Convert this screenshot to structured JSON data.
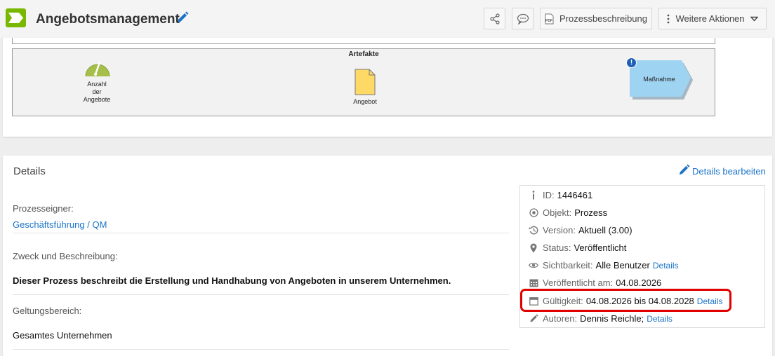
{
  "header": {
    "title": "Angebotsmanagement",
    "process_description_label": "Prozessbeschreibung",
    "more_actions_label": "Weitere Aktionen",
    "pdf_badge": "PDF"
  },
  "diagram": {
    "artefacts_title": "Artefakte",
    "gauge_label": "Anzahl\nder\nAngebote",
    "document_label": "Angebot",
    "measure_label": "Maßnahme",
    "info_badge": "!"
  },
  "details": {
    "title": "Details",
    "edit_label": "Details bearbeiten",
    "owner_label": "Prozesseigner:",
    "owner_value": "Geschäftsführung / QM",
    "purpose_label": "Zweck und Beschreibung:",
    "purpose_value": "Dieser Prozess beschreibt die Erstellung und Handhabung von Angeboten in unserem Unternehmen.",
    "scope_label": "Geltungsbereich:",
    "scope_value": "Gesamtes Unternehmen"
  },
  "meta": {
    "id_key": "ID:",
    "id_val": "1446461",
    "object_key": "Objekt:",
    "object_val": "Prozess",
    "version_key": "Version:",
    "version_val": "Aktuell (3.00)",
    "status_key": "Status:",
    "status_val": "Veröffentlicht",
    "visibility_key": "Sichtbarkeit:",
    "visibility_val": "Alle Benutzer",
    "visibility_link": "Details",
    "published_key": "Veröffentlicht am:",
    "published_val": "04.08.2026",
    "validity_key": "Gültigkeit:",
    "validity_val": "04.08.2026 bis 04.08.2028",
    "validity_link": "Details",
    "authors_key": "Autoren:",
    "authors_val": "Dennis Reichle;",
    "authors_link": "Details"
  },
  "colors": {
    "brand_green": "#7ab800",
    "link_blue": "#1a73c8",
    "highlight_red": "#e00000",
    "document_yellow": "#ffd966",
    "measure_blue": "#9fd3f2"
  }
}
